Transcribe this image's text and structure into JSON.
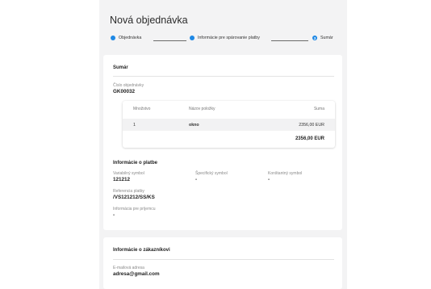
{
  "page_title": "Nová objednávka",
  "stepper": {
    "step1": "Objednávka",
    "step2": "Informácie pre spárovanie platby",
    "step3_num": "3",
    "step3": "Sumár"
  },
  "summary": {
    "title": "Sumár",
    "order_number_label": "Číslo objednávky",
    "order_number": "GK00032",
    "table": {
      "headers": [
        "Množstvo",
        "Názov položky",
        "Suma"
      ],
      "rows": [
        {
          "qty": "1",
          "name": "okno",
          "amount": "2356,00 EUR"
        }
      ],
      "total": "2356,00 EUR"
    }
  },
  "payment": {
    "title": "Informácie o platbe",
    "variable_symbol_label": "Variabilný symbol",
    "variable_symbol": "121212",
    "specific_symbol_label": "Špecifický symbol",
    "specific_symbol": "-",
    "constant_symbol_label": "Konštantný symbol",
    "constant_symbol": "-",
    "reference_label": "Referencia platby",
    "reference": "/VS121212/SS/KS",
    "recipient_info_label": "Informácia pre príjemcu",
    "recipient_info": "-"
  },
  "customer": {
    "title": "Informácie o zákazníkovi",
    "email_label": "E-mailová adresa",
    "email": "adresa@gmail.com"
  },
  "colors": {
    "accent": "#1e88e5",
    "background": "#f3f3f4"
  }
}
